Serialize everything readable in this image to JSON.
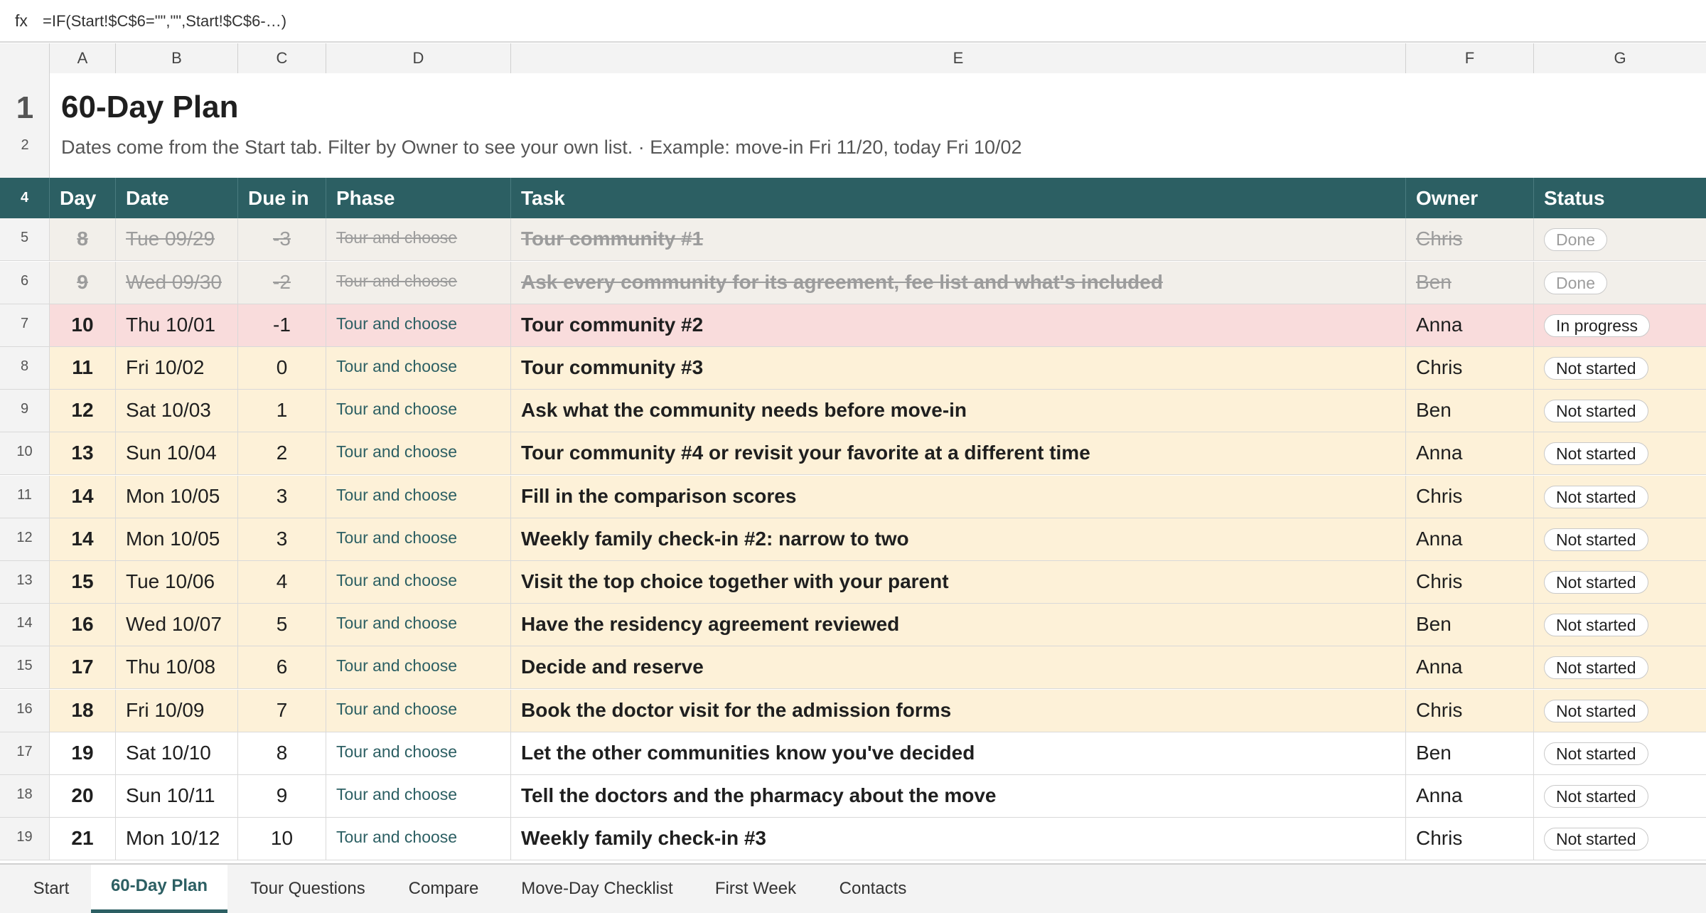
{
  "formula_bar": {
    "fx_label": "fx",
    "formula": "=IF(Start!$C$6=\"\",\"\",Start!$C$6-…)"
  },
  "columns": [
    "A",
    "B",
    "C",
    "D",
    "E",
    "F",
    "G"
  ],
  "title_rows": {
    "title_row_num": "1",
    "title": "60-Day Plan",
    "subtitle_row_num": "2",
    "subtitle": "Dates come from the Start tab. Filter by Owner to see your own list.  ·  Example: move-in Fri 11/20, today Fri 10/02"
  },
  "table": {
    "header_row_num": "4",
    "headers": {
      "day": "Day",
      "date": "Date",
      "due_in": "Due in",
      "phase": "Phase",
      "task": "Task",
      "owner": "Owner",
      "status": "Status"
    },
    "rows": [
      {
        "row_num": "5",
        "day": "8",
        "date": "Tue 09/29",
        "due_in": "-3",
        "phase": "Tour and choose",
        "task": "Tour community #1",
        "owner": "Chris",
        "status": "Done",
        "state": "done"
      },
      {
        "row_num": "6",
        "day": "9",
        "date": "Wed 09/30",
        "due_in": "-2",
        "phase": "Tour and choose",
        "task": "Ask every community for its agreement, fee list and what's included",
        "owner": "Ben",
        "status": "Done",
        "state": "done"
      },
      {
        "row_num": "7",
        "day": "10",
        "date": "Thu 10/01",
        "due_in": "-1",
        "phase": "Tour and choose",
        "task": "Tour community #2",
        "owner": "Anna",
        "status": "In progress",
        "state": "progress"
      },
      {
        "row_num": "8",
        "day": "11",
        "date": "Fri 10/02",
        "due_in": "0",
        "phase": "Tour and choose",
        "task": "Tour community #3",
        "owner": "Chris",
        "status": "Not started",
        "state": "upcoming"
      },
      {
        "row_num": "9",
        "day": "12",
        "date": "Sat 10/03",
        "due_in": "1",
        "phase": "Tour and choose",
        "task": "Ask what the community needs before move-in",
        "owner": "Ben",
        "status": "Not started",
        "state": "upcoming"
      },
      {
        "row_num": "10",
        "day": "13",
        "date": "Sun 10/04",
        "due_in": "2",
        "phase": "Tour and choose",
        "task": "Tour community #4 or revisit your favorite at a different time",
        "owner": "Anna",
        "status": "Not started",
        "state": "upcoming"
      },
      {
        "row_num": "11",
        "day": "14",
        "date": "Mon 10/05",
        "due_in": "3",
        "phase": "Tour and choose",
        "task": "Fill in the comparison scores",
        "owner": "Chris",
        "status": "Not started",
        "state": "upcoming"
      },
      {
        "row_num": "12",
        "day": "14",
        "date": "Mon 10/05",
        "due_in": "3",
        "phase": "Tour and choose",
        "task": "Weekly family check-in #2: narrow to two",
        "owner": "Anna",
        "status": "Not started",
        "state": "upcoming"
      },
      {
        "row_num": "13",
        "day": "15",
        "date": "Tue 10/06",
        "due_in": "4",
        "phase": "Tour and choose",
        "task": "Visit the top choice together with your parent",
        "owner": "Chris",
        "status": "Not started",
        "state": "upcoming"
      },
      {
        "row_num": "14",
        "day": "16",
        "date": "Wed 10/07",
        "due_in": "5",
        "phase": "Tour and choose",
        "task": "Have the residency agreement reviewed",
        "owner": "Ben",
        "status": "Not started",
        "state": "upcoming"
      },
      {
        "row_num": "15",
        "day": "17",
        "date": "Thu 10/08",
        "due_in": "6",
        "phase": "Tour and choose",
        "task": "Decide and reserve",
        "owner": "Anna",
        "status": "Not started",
        "state": "upcoming"
      },
      {
        "row_num": "16",
        "day": "18",
        "date": "Fri 10/09",
        "due_in": "7",
        "phase": "Tour and choose",
        "task": "Book the doctor visit for the admission forms",
        "owner": "Chris",
        "status": "Not started",
        "state": "upcoming"
      },
      {
        "row_num": "17",
        "day": "19",
        "date": "Sat 10/10",
        "due_in": "8",
        "phase": "Tour and choose",
        "task": "Let the other communities know you've decided",
        "owner": "Ben",
        "status": "Not started",
        "state": "normal"
      },
      {
        "row_num": "18",
        "day": "20",
        "date": "Sun 10/11",
        "due_in": "9",
        "phase": "Tour and choose",
        "task": "Tell the doctors and the pharmacy about the move",
        "owner": "Anna",
        "status": "Not started",
        "state": "normal"
      },
      {
        "row_num": "19",
        "day": "21",
        "date": "Mon 10/12",
        "due_in": "10",
        "phase": "Tour and choose",
        "task": "Weekly family check-in #3",
        "owner": "Chris",
        "status": "Not started",
        "state": "normal"
      }
    ]
  },
  "sheet_tabs": [
    {
      "label": "Start",
      "active": false
    },
    {
      "label": "60-Day Plan",
      "active": true
    },
    {
      "label": "Tour Questions",
      "active": false
    },
    {
      "label": "Compare",
      "active": false
    },
    {
      "label": "Move-Day Checklist",
      "active": false
    },
    {
      "label": "First Week",
      "active": false
    },
    {
      "label": "Contacts",
      "active": false
    }
  ],
  "colors": {
    "header_bg": "#2c5f63",
    "done_row": "#f2efea",
    "in_progress_row": "#f9dcdc",
    "upcoming_row": "#fdf1d8",
    "normal_row": "#ffffff"
  }
}
